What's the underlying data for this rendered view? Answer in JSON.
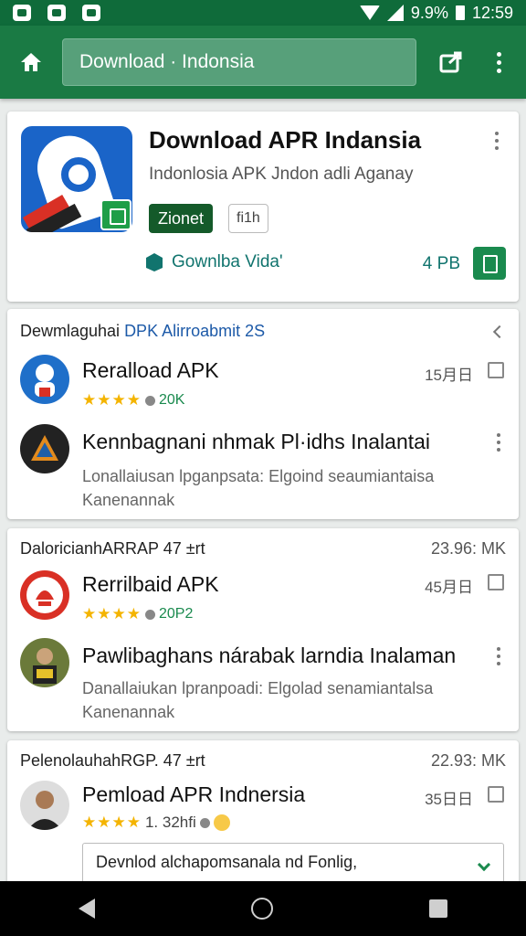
{
  "status": {
    "battery": "9.9%",
    "time": "12:59"
  },
  "search": {
    "query": "Download · Indonsia"
  },
  "hero": {
    "title": "Download APR Indansia",
    "subtitle": "Indonlosia APK Jndon adli Aganay",
    "badge_primary": "Zionet",
    "badge_secondary": "fi1h",
    "download_label": "Gownlba Vida'",
    "size": "4 PB"
  },
  "section1": {
    "title_prefix": "Dewmlaguhai ",
    "title_accent": "DPK Alirroabmit 2S",
    "items": [
      {
        "title": "Reralload APK",
        "stars": "★★★★",
        "rating": "20K",
        "side": "15月日"
      },
      {
        "title": "Kennbagnani nhmak Pl·idhs Inalantai",
        "body": "Lonallaiusan lpganpsata: Elgoind seaumiantaisa Kanenannak"
      }
    ]
  },
  "section2": {
    "title": "DaloricianhARRAP 47 ±rt",
    "right": "23.96: MK",
    "items": [
      {
        "title": "Rerrilbaid APK",
        "stars": "★★★★",
        "rating": "20P2",
        "side": "45月日"
      },
      {
        "title": "Pawlibaghans nárabak larndia Inalaman",
        "body": "Danallaiukan lpranpoadi: Elgolad senamiantalsa Kanenannak"
      }
    ]
  },
  "section3": {
    "title": "PelenolauhahRGP. 47 ±rt",
    "right": "22.93: MK",
    "items": [
      {
        "title": "Pemload APR Indnersia",
        "stars": "★★★★",
        "rating": "1. 32hfi",
        "side": "35日日"
      }
    ],
    "dropdown": "Devnlod alchapomsanala nd Fonlig,"
  },
  "colors": {
    "primary": "#1a7a44",
    "status": "#0f6b3a",
    "star": "#f4b400",
    "accent": "#11746e"
  }
}
